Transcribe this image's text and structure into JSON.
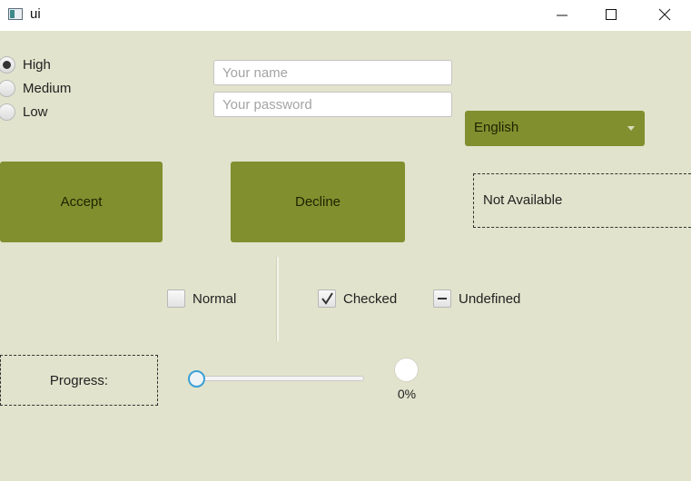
{
  "window": {
    "title": "ui",
    "icons": {
      "app": "app-window-icon",
      "minimize": "minimize-icon",
      "maximize": "maximize-icon",
      "close": "close-icon"
    }
  },
  "radios": [
    {
      "label": "High",
      "selected": true
    },
    {
      "label": "Medium",
      "selected": false
    },
    {
      "label": "Low",
      "selected": false
    }
  ],
  "form": {
    "name_placeholder": "Your name",
    "password_placeholder": "Your password"
  },
  "language": {
    "selected": "English",
    "icon": "chevron-down-icon"
  },
  "buttons": {
    "accept": "Accept",
    "decline": "Decline"
  },
  "status_label": "Not Available",
  "checkboxes": [
    {
      "label": "Normal",
      "state": "unchecked"
    },
    {
      "label": "Checked",
      "state": "checked"
    },
    {
      "label": "Undefined",
      "state": "indeterminate"
    }
  ],
  "progress": {
    "label": "Progress:",
    "slider_value": 0,
    "indicator_text": "0%"
  },
  "colors": {
    "background": "#e1e3cc",
    "accent": "#818f2f",
    "slider_focus": "#3a9fd6"
  }
}
